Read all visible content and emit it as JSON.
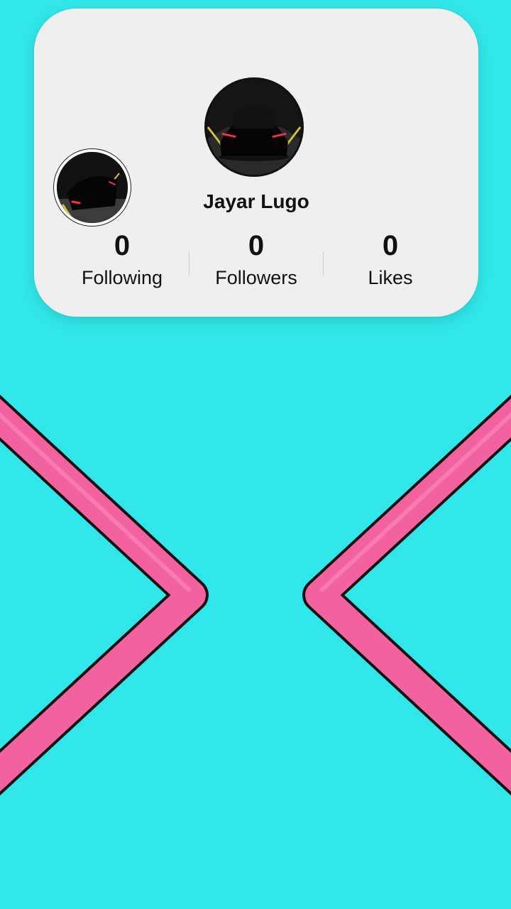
{
  "profile": {
    "username": "Jayar Lugo",
    "main_avatar_icon": "car-avatar-icon",
    "secondary_avatar_icon": "car-avatar-icon"
  },
  "stats": [
    {
      "value": "0",
      "label": "Following"
    },
    {
      "value": "0",
      "label": "Followers"
    },
    {
      "value": "0",
      "label": "Likes"
    }
  ],
  "colors": {
    "background": "#31e6e8",
    "card": "#efefef",
    "chevron_fill": "#f2629e",
    "chevron_outline": "#111111"
  }
}
